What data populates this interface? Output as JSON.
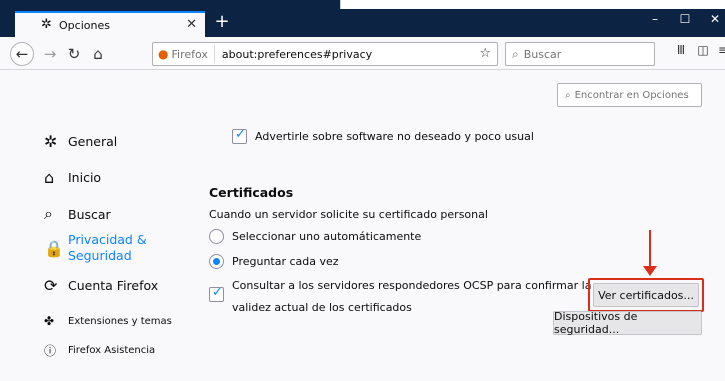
{
  "browser": {
    "tab_title": "Opciones",
    "new_tab": "+",
    "window_controls": {
      "minimize": "–",
      "maximize": "☐",
      "close": "✕"
    },
    "identity_label": "Firefox",
    "url": "about:preferences#privacy",
    "search_placeholder": "Buscar"
  },
  "find": {
    "placeholder": "Encontrar en Opciones"
  },
  "sidebar": {
    "items": [
      {
        "label": "General",
        "icon": "gear-icon"
      },
      {
        "label": "Inicio",
        "icon": "home-icon"
      },
      {
        "label": "Buscar",
        "icon": "search-icon"
      },
      {
        "label": "Privacidad &\nSeguridad",
        "icon": "lock-icon"
      },
      {
        "label": "Cuenta Firefox",
        "icon": "sync-icon"
      },
      {
        "label": "Extensiones y temas",
        "icon": "puzzle-icon"
      },
      {
        "label": "Firefox Asistencia",
        "icon": "help-icon"
      }
    ]
  },
  "main": {
    "warn_unwanted": "Advertirle sobre software no deseado y poco usual",
    "certs_title": "Certificados",
    "certs_prompt": "Cuando un servidor solicite su certificado personal",
    "radio_auto": "Seleccionar uno automáticamente",
    "radio_ask": "Preguntar cada vez",
    "ocsp_line1": "Consultar a los servidores respondedores OCSP para confirmar la",
    "ocsp_line2": "validez actual de los certificados",
    "view_certs_button": "Ver certificados...",
    "security_devices_button": "Dispositivos de seguridad..."
  },
  "colors": {
    "accent": "#0a84ff",
    "highlight": "#d92e1a",
    "tabbar": "#0c2344"
  }
}
